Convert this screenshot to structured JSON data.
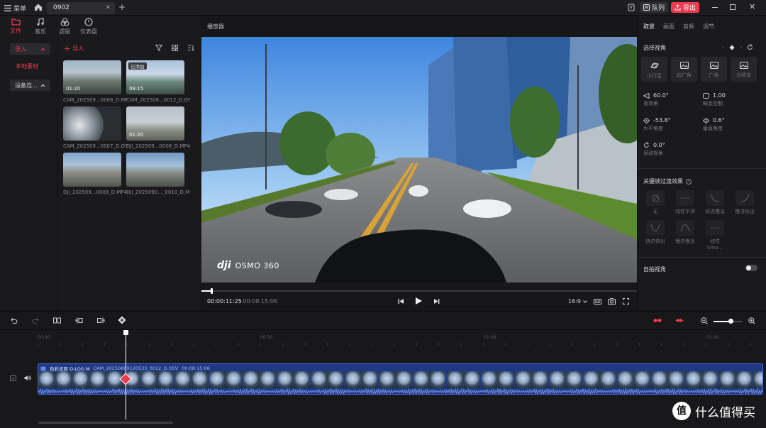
{
  "titlebar": {
    "menu_label": "菜单",
    "tab_title": "0902",
    "queue_label": "队列",
    "export_label": "导出"
  },
  "library": {
    "tools": [
      {
        "label": "文件",
        "icon": "folder-icon",
        "active": true
      },
      {
        "label": "音乐",
        "icon": "music-icon",
        "active": false
      },
      {
        "label": "滤镜",
        "icon": "filter-icon",
        "active": false
      },
      {
        "label": "仪表盘",
        "icon": "gauge-icon",
        "active": false
      }
    ],
    "import_label": "导入",
    "local_media_label": "本地素材",
    "device_label": "设备连...",
    "import_button_label": "导入",
    "media": [
      {
        "name": "CAM_202509...0006_D.MP4",
        "duration": "01:20",
        "badge": ""
      },
      {
        "name": "CAM_202508...0012_D.OSV",
        "duration": "08:15",
        "badge": "已添加"
      },
      {
        "name": "CAM_202509...0007_D.OSV",
        "duration": "",
        "badge": ""
      },
      {
        "name": "DJI_202509...0008_D.MP4",
        "duration": "01:20",
        "badge": ""
      },
      {
        "name": "DJI_202509...0009_D.MP4",
        "duration": "",
        "badge": ""
      },
      {
        "name": "DJI_2025090..._0010_D.MP4",
        "duration": "",
        "badge": ""
      }
    ]
  },
  "player": {
    "title": "播放器",
    "watermark_brand": "dji",
    "watermark_model": "OSMO 360",
    "current_time": "00:00:11:25",
    "total_time": "/ 00:08:15:06",
    "aspect_ratio": "16:9",
    "progress": 0.022
  },
  "properties": {
    "tabs": [
      "取景",
      "画面",
      "音频",
      "调节"
    ],
    "section_view": "选择视角",
    "view_modes": [
      "小行星",
      "超广角",
      "广角",
      "去畸变"
    ],
    "fov_value": "60.0°",
    "fov_label": "视场角",
    "distortion_value": "1.00",
    "distortion_label": "畸变控制",
    "pan_value": "-53.8°",
    "pan_label": "水平角度",
    "tilt_value": "0.6°",
    "tilt_label": "垂直角度",
    "roll_value": "0.0°",
    "roll_label": "滚动视角",
    "section_keyframe": "关键帧过渡效果",
    "keyframe_effects": [
      "无",
      "线性平滑",
      "快进慢出",
      "慢进快出",
      "快进快出",
      "慢进慢出",
      "线性Smo..."
    ],
    "selfie_label": "自拍视角"
  },
  "timeline": {
    "ruler": [
      "00:00",
      "00:30",
      "01:00",
      "01:30"
    ],
    "clip_filter": "色彩还原 D-LOG M",
    "clip_name": "CAM_20250809120533_0012_D.OSV",
    "clip_duration": "00:08:15:06",
    "zoom_level": 0.6
  },
  "colors": {
    "accent": "#ef3b4f",
    "clip_blue": "#1f3a84",
    "playhead": "#ffffff"
  },
  "watermark_site": {
    "logo_glyph": "值",
    "text": "什么值得买"
  }
}
